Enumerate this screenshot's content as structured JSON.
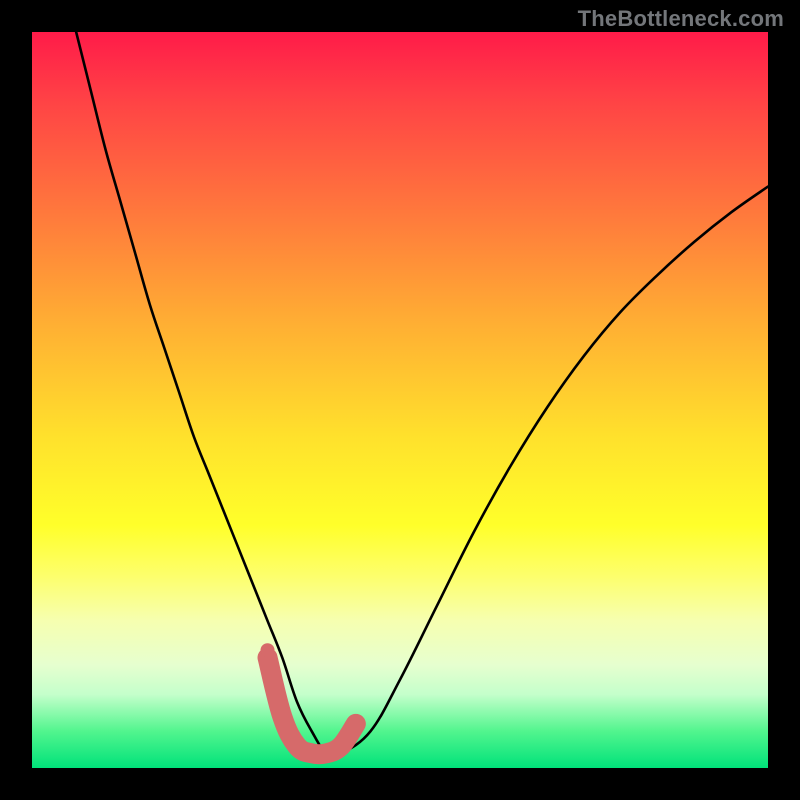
{
  "watermark": "TheBottleneck.com",
  "chart_data": {
    "type": "line",
    "title": "",
    "xlabel": "",
    "ylabel": "",
    "xlim": [
      0,
      100
    ],
    "ylim": [
      0,
      100
    ],
    "series": [
      {
        "name": "bottleneck-curve",
        "x": [
          6,
          8,
          10,
          12,
          14,
          16,
          18,
          20,
          22,
          24,
          26,
          28,
          30,
          32,
          34,
          36,
          38,
          40,
          42,
          46,
          50,
          55,
          60,
          65,
          70,
          75,
          80,
          85,
          90,
          95,
          100
        ],
        "values": [
          100,
          92,
          84,
          77,
          70,
          63,
          57,
          51,
          45,
          40,
          35,
          30,
          25,
          20,
          15,
          9,
          5,
          2,
          2,
          5,
          12,
          22,
          32,
          41,
          49,
          56,
          62,
          67,
          71.5,
          75.5,
          79
        ]
      }
    ],
    "highlight": {
      "name": "optimal-region",
      "x": [
        32,
        34,
        36,
        38,
        40,
        42,
        44
      ],
      "values": [
        15,
        7,
        3,
        2,
        2,
        3,
        6
      ]
    },
    "marker": {
      "x": 32,
      "y": 16
    },
    "gradient_stops": [
      {
        "pos": 0,
        "color": "#ff1b49"
      },
      {
        "pos": 25,
        "color": "#ff7a3c"
      },
      {
        "pos": 55,
        "color": "#ffe12c"
      },
      {
        "pos": 80,
        "color": "#f6ffb0"
      },
      {
        "pos": 100,
        "color": "#00e27a"
      }
    ]
  }
}
